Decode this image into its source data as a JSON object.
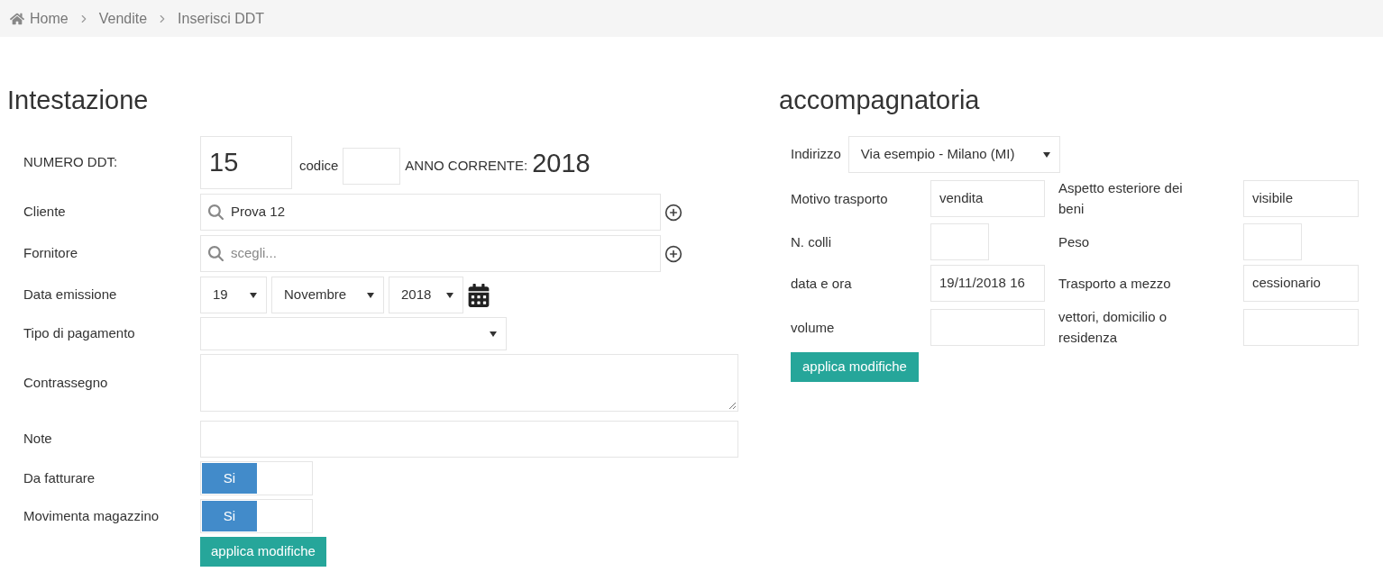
{
  "breadcrumb": [
    {
      "label": "Home"
    },
    {
      "label": "Vendite"
    },
    {
      "label": "Inserisci DDT"
    }
  ],
  "intestazione": {
    "title": "Intestazione",
    "numero": {
      "label": "NUMERO DDT:",
      "value": "15",
      "codice_label": "codice",
      "anno_label": "ANNO CORRENTE:",
      "anno_value": "2018"
    },
    "fields": [
      {
        "kind": "search",
        "label": "Cliente",
        "value": "Prova 12"
      },
      {
        "kind": "search",
        "label": "Fornitore",
        "placeholder": "scegli..."
      },
      {
        "kind": "date",
        "label": "Data emissione",
        "day": "19",
        "month": "Novembre",
        "year": "2018"
      },
      {
        "kind": "select",
        "label": "Tipo di pagamento"
      },
      {
        "kind": "textarea",
        "label": "Contrassegno"
      },
      {
        "kind": "text",
        "label": "Note"
      },
      {
        "kind": "toggle",
        "label": "Da fatturare",
        "on": true,
        "on_label": "Si"
      },
      {
        "kind": "toggle",
        "label": "Movimenta magazzino",
        "on": true,
        "on_label": "Si"
      }
    ],
    "button": "applica modifiche"
  },
  "accompagnatoria": {
    "title": "accompagnatoria",
    "indirizzo": {
      "label": "Indirizzo",
      "value": "Via esempio - Milano (MI)"
    },
    "rows": [
      [
        {
          "label": "Motivo trasporto",
          "value": "vendita",
          "short": false
        },
        {
          "label": "Aspetto esteriore dei beni",
          "value": "visibile",
          "short": false
        }
      ],
      [
        {
          "label": "N. colli",
          "short": true
        },
        {
          "label": "Peso",
          "short": true
        }
      ],
      [
        {
          "label": "data e ora",
          "value": "19/11/2018 16",
          "short": false
        },
        {
          "label": "Trasporto a mezzo",
          "value": "cessionario",
          "short": false
        }
      ],
      [
        {
          "label": "volume",
          "short": false
        },
        {
          "label": "vettori, domicilio o residenza",
          "short": false
        }
      ]
    ],
    "button": "applica modifiche"
  }
}
